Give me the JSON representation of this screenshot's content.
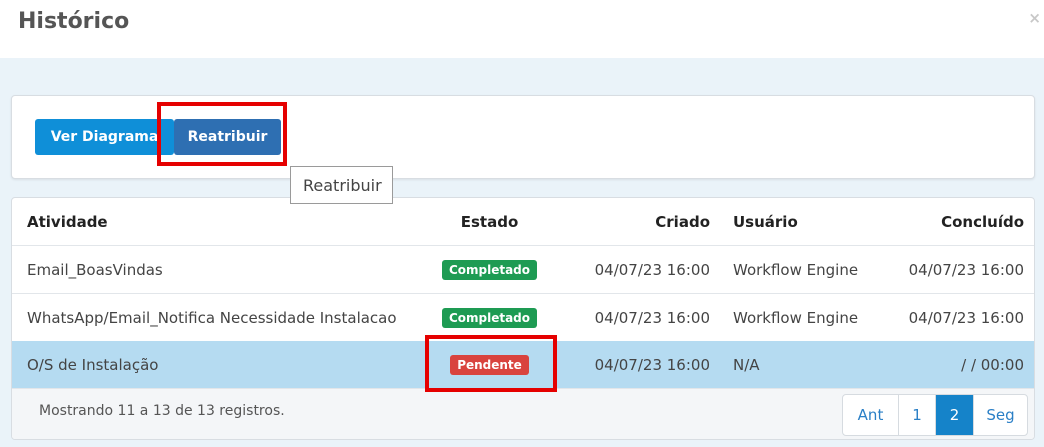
{
  "modal": {
    "title": "Histórico",
    "close_label": "×"
  },
  "toolbar": {
    "diagrama_label": "Ver Diagrama",
    "reatribuir_label": "Reatribuir",
    "tooltip": "Reatribuir"
  },
  "table": {
    "columns": [
      "Atividade",
      "Estado",
      "Criado",
      "Usuário",
      "Concluído"
    ],
    "rows": [
      {
        "atividade": "Email_BoasVindas",
        "estado": "Completado",
        "criado": "04/07/23 16:00",
        "usuario": "Workflow Engine",
        "concluido": "04/07/23 16:00"
      },
      {
        "atividade": "WhatsApp/Email_Notifica Necessidade Instalacao",
        "estado": "Completado",
        "criado": "04/07/23 16:00",
        "usuario": "Workflow Engine",
        "concluido": "04/07/23 16:00"
      },
      {
        "atividade": "O/S de Instalação",
        "estado": "Pendente",
        "criado": "04/07/23 16:00",
        "usuario": "N/A",
        "concluido": "/ / 00:00"
      }
    ]
  },
  "footer": {
    "summary": "Mostrando 11 a 13 de 13 registros.",
    "pager": {
      "prev": "Ant",
      "page1": "1",
      "page2": "2",
      "next": "Seg"
    }
  },
  "colors": {
    "primary": "#0f8fd8",
    "reatribuir": "#2e6fb2",
    "completado": "#1e9b53",
    "pendente": "#d9433e",
    "selected_row": "#b5dbf1",
    "highlight": "#e50000"
  }
}
